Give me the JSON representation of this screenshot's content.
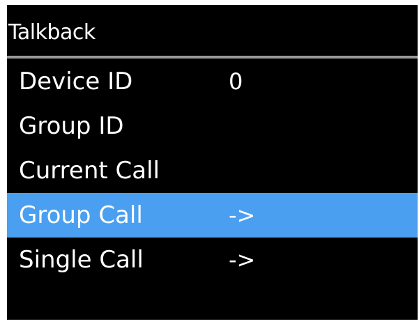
{
  "header": {
    "title": "Talkback"
  },
  "colors": {
    "background": "#000000",
    "text": "#ffffff",
    "selection": "#4a9ff0",
    "divider": "#9a9a9a"
  },
  "menu": {
    "items": [
      {
        "label": "Device ID",
        "value": "0",
        "selected": false
      },
      {
        "label": "Group ID",
        "value": "",
        "selected": false
      },
      {
        "label": "Current Call",
        "value": "",
        "selected": false
      },
      {
        "label": "Group Call",
        "value": "->",
        "selected": true
      },
      {
        "label": "Single Call",
        "value": "->",
        "selected": false
      }
    ]
  }
}
